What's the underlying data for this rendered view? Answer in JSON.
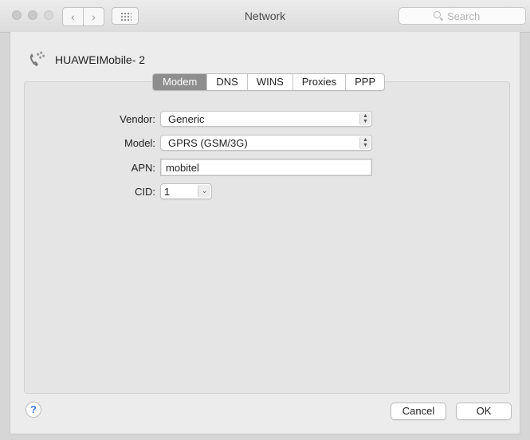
{
  "window": {
    "title": "Network"
  },
  "toolbar": {
    "search_placeholder": "Search"
  },
  "device": {
    "name": "HUAWEIMobile- 2"
  },
  "tabs": [
    {
      "label": "Modem",
      "active": true
    },
    {
      "label": "DNS",
      "active": false
    },
    {
      "label": "WINS",
      "active": false
    },
    {
      "label": "Proxies",
      "active": false
    },
    {
      "label": "PPP",
      "active": false
    }
  ],
  "form": {
    "vendor": {
      "label": "Vendor:",
      "value": "Generic"
    },
    "model": {
      "label": "Model:",
      "value": "GPRS (GSM/3G)"
    },
    "apn": {
      "label": "APN:",
      "value": "mobitel"
    },
    "cid": {
      "label": "CID:",
      "value": "1"
    }
  },
  "buttons": {
    "help": "?",
    "cancel": "Cancel",
    "ok": "OK"
  }
}
